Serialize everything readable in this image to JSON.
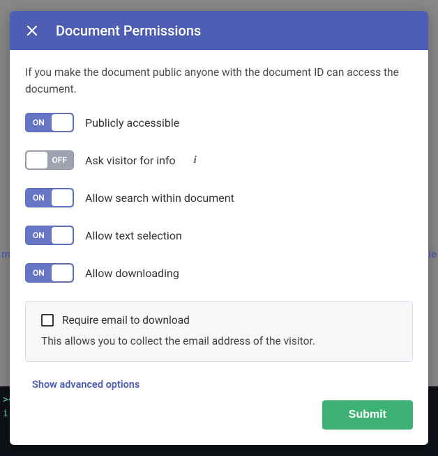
{
  "modal": {
    "title": "Document Permissions",
    "description": "If you make the document public anyone with the document ID can access the document.",
    "toggles": [
      {
        "state": "ON",
        "label": "Publicly accessible"
      },
      {
        "state": "OFF",
        "label": "Ask visitor for info",
        "info": true
      },
      {
        "state": "ON",
        "label": "Allow search within document"
      },
      {
        "state": "ON",
        "label": "Allow text selection"
      },
      {
        "state": "ON",
        "label": "Allow downloading"
      }
    ],
    "sub_panel": {
      "checkbox_label": "Require email to download",
      "checkbox_checked": false,
      "description": "This allows you to collect the email address of the visitor."
    },
    "advanced_label": "Show advanced options",
    "submit_label": "Submit"
  },
  "background": {
    "left_fragment": "m",
    "right_fragment": "vie",
    "term_line1": ">< ",
    "term_line2": " i"
  },
  "colors": {
    "header": "#4c5db3",
    "toggle_on": "#6776c4",
    "toggle_off": "#9fa3b0",
    "submit": "#3eb274"
  }
}
